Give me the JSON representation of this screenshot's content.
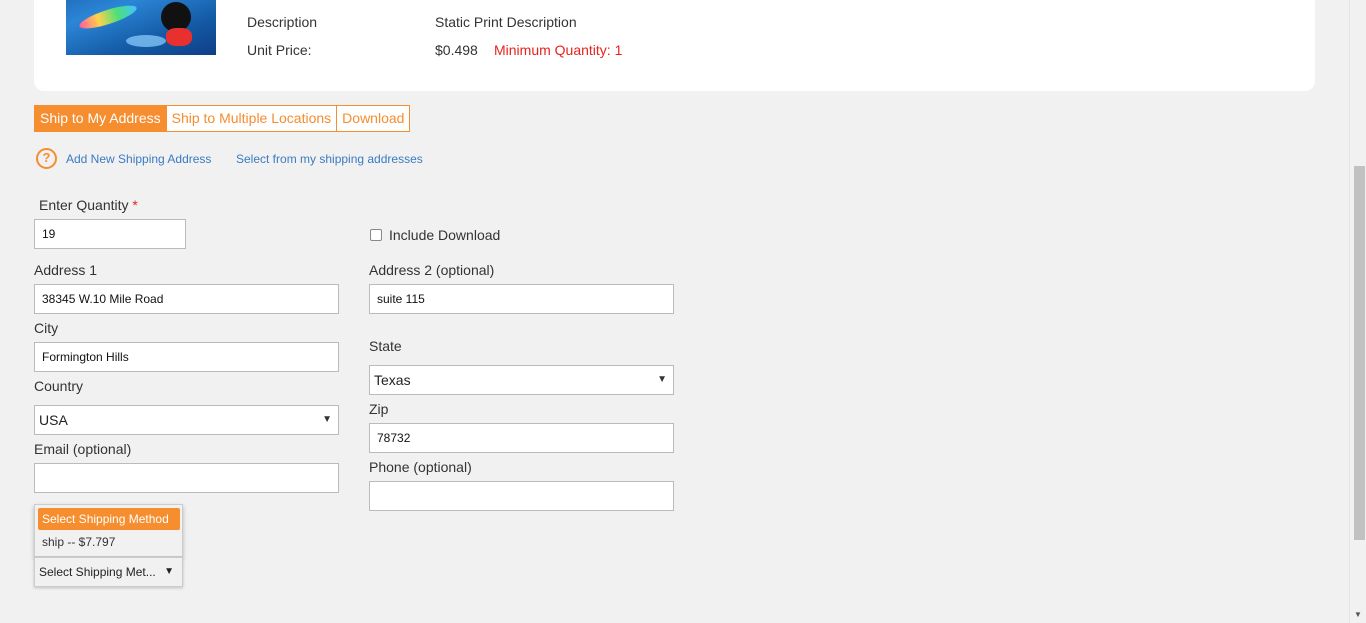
{
  "product": {
    "description_label": "Description",
    "description_value": "Static Print Description",
    "unit_price_label": "Unit Price:",
    "unit_price_value": "$0.498",
    "min_quantity": "Minimum Quantity: 1"
  },
  "tabs": [
    {
      "label": "Ship to My Address",
      "active": true
    },
    {
      "label": "Ship to Multiple Locations",
      "active": false
    },
    {
      "label": "Download",
      "active": false
    }
  ],
  "links": {
    "add_address": "Add New Shipping Address",
    "select_address": "Select from my shipping addresses",
    "help_icon": "?"
  },
  "form": {
    "quantity_label": "Enter Quantity",
    "required_mark": "*",
    "quantity_value": "19",
    "include_download_label": "Include Download",
    "address1_label": "Address 1",
    "address1_value": "38345 W.10 Mile Road",
    "address2_label": "Address 2 (optional)",
    "address2_value": "suite 115",
    "city_label": "City",
    "city_value": "Formington Hills",
    "state_label": "State",
    "state_value": "Texas",
    "country_label": "Country",
    "country_value": "USA",
    "zip_label": "Zip",
    "zip_value": "78732",
    "email_label": "Email (optional)",
    "email_value": "",
    "phone_label": "Phone (optional)",
    "phone_value": ""
  },
  "shipping": {
    "highlighted_option": "Select Shipping Method",
    "option": "ship -- $7.797",
    "select_text": "Select Shipping Met...",
    "arrow": "▼"
  },
  "colors": {
    "accent": "#f68d2e",
    "link": "#3a7bc2",
    "warning": "#e8231d"
  }
}
